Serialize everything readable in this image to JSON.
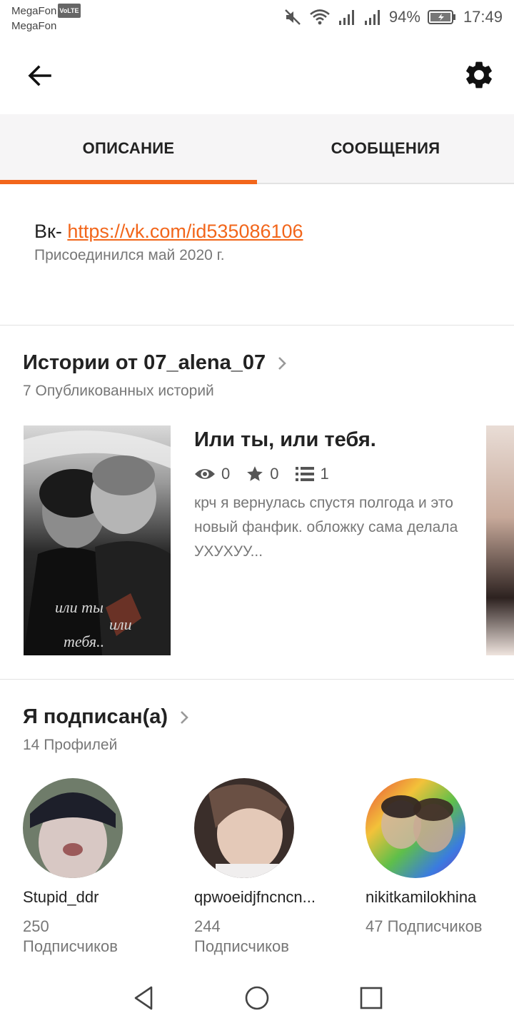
{
  "status_bar": {
    "carrier1": "MegaFon",
    "volte": "VoLTE",
    "carrier2": "MegaFon",
    "battery": "94%",
    "time": "17:49"
  },
  "tabs": [
    {
      "label": "ОПИСАНИЕ",
      "active": true
    },
    {
      "label": "СООБЩЕНИЯ",
      "active": false
    }
  ],
  "description": {
    "prefix": "Вк- ",
    "link": "https://vk.com/id535086106",
    "joined": "Присоединился май 2020 г."
  },
  "stories": {
    "title": "Истории от 07_alena_07",
    "subtitle": "7 Опубликованных историй",
    "items": [
      {
        "title": "Или ты, или тебя.",
        "views": "0",
        "votes": "0",
        "parts": "1",
        "description": "крч я вернулась спустя полгода и это новый фанфик. обложку сама делала УХУХУУ...",
        "cover_text": [
          "или ты",
          "или",
          "тебя.."
        ]
      }
    ]
  },
  "following": {
    "title": "Я подписан(а)",
    "subtitle": "14 Профилей",
    "profiles": [
      {
        "name": "Stupid_ddr",
        "followers": "250 Подписчиков"
      },
      {
        "name": "qpwoeidjfncncn...",
        "followers": "244 Подписчиков"
      },
      {
        "name": "nikitkamilokhina",
        "followers": "47 Подписчиков"
      }
    ]
  },
  "colors": {
    "accent": "#f2661b"
  }
}
